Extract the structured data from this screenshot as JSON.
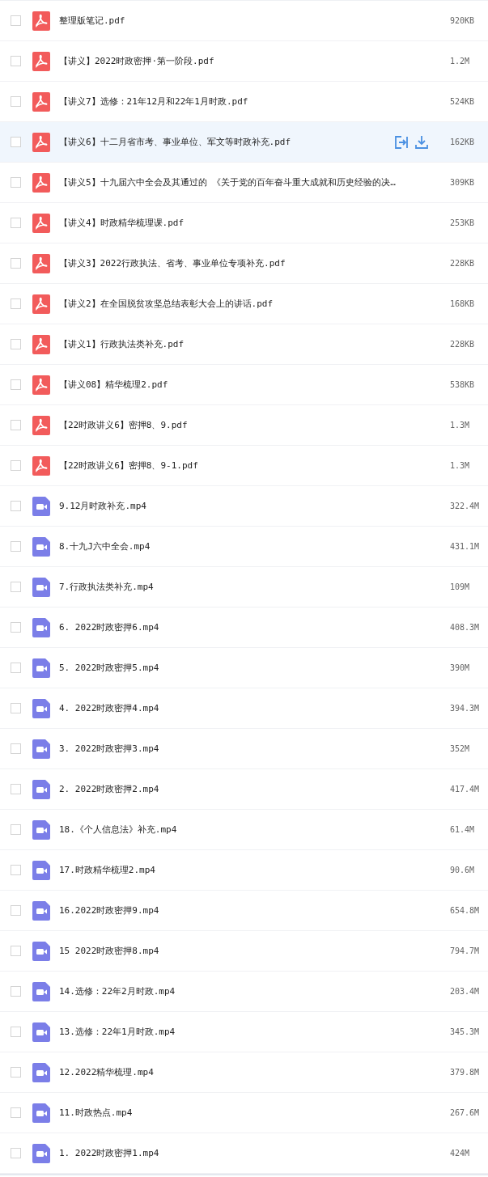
{
  "files": [
    {
      "kind": "pdf",
      "name": "整理版笔记.pdf",
      "size": "920KB",
      "checked": false,
      "hovered": false
    },
    {
      "kind": "pdf",
      "name": "【讲义】2022时政密押·第一阶段.pdf",
      "size": "1.2M",
      "checked": false,
      "hovered": false
    },
    {
      "kind": "pdf",
      "name": "【讲义7】选修：21年12月和22年1月时政.pdf",
      "size": "524KB",
      "checked": false,
      "hovered": false
    },
    {
      "kind": "pdf",
      "name": "【讲义6】十二月省市考、事业单位、军文等时政补充.pdf",
      "size": "162KB",
      "checked": false,
      "hovered": true
    },
    {
      "kind": "pdf",
      "name": "【讲义5】十九届六中全会及其通过的 《关于党的百年奋斗重大成就和历史经验的决…",
      "size": "309KB",
      "checked": false,
      "hovered": false
    },
    {
      "kind": "pdf",
      "name": "【讲义4】时政精华梳理课.pdf",
      "size": "253KB",
      "checked": false,
      "hovered": false
    },
    {
      "kind": "pdf",
      "name": "【讲义3】2022行政执法、省考、事业单位专项补充.pdf",
      "size": "228KB",
      "checked": false,
      "hovered": false
    },
    {
      "kind": "pdf",
      "name": "【讲义2】在全国脱贫攻坚总结表彰大会上的讲话.pdf",
      "size": "168KB",
      "checked": false,
      "hovered": false
    },
    {
      "kind": "pdf",
      "name": "【讲义1】行政执法类补充.pdf",
      "size": "228KB",
      "checked": false,
      "hovered": false
    },
    {
      "kind": "pdf",
      "name": "【讲义08】精华梳理2.pdf",
      "size": "538KB",
      "checked": false,
      "hovered": false
    },
    {
      "kind": "pdf",
      "name": "【22时政讲义6】密押8、9.pdf",
      "size": "1.3M",
      "checked": false,
      "hovered": false
    },
    {
      "kind": "pdf",
      "name": "【22时政讲义6】密押8、9-1.pdf",
      "size": "1.3M",
      "checked": false,
      "hovered": false
    },
    {
      "kind": "video",
      "name": "9.12月时政补充.mp4",
      "size": "322.4M",
      "checked": false,
      "hovered": false
    },
    {
      "kind": "video",
      "name": "8.十九J六中全会.mp4",
      "size": "431.1M",
      "checked": false,
      "hovered": false
    },
    {
      "kind": "video",
      "name": "7.行政执法类补充.mp4",
      "size": "109M",
      "checked": false,
      "hovered": false
    },
    {
      "kind": "video",
      "name": "6. 2022时政密押6.mp4",
      "size": "408.3M",
      "checked": false,
      "hovered": false
    },
    {
      "kind": "video",
      "name": "5. 2022时政密押5.mp4",
      "size": "390M",
      "checked": false,
      "hovered": false
    },
    {
      "kind": "video",
      "name": "4. 2022时政密押4.mp4",
      "size": "394.3M",
      "checked": false,
      "hovered": false
    },
    {
      "kind": "video",
      "name": "3. 2022时政密押3.mp4",
      "size": "352M",
      "checked": false,
      "hovered": false
    },
    {
      "kind": "video",
      "name": "2. 2022时政密押2.mp4",
      "size": "417.4M",
      "checked": false,
      "hovered": false
    },
    {
      "kind": "video",
      "name": "18.《个人信息法》补充.mp4",
      "size": "61.4M",
      "checked": false,
      "hovered": false
    },
    {
      "kind": "video",
      "name": "17.时政精华梳理2.mp4",
      "size": "90.6M",
      "checked": false,
      "hovered": false
    },
    {
      "kind": "video",
      "name": "16.2022时政密押9.mp4",
      "size": "654.8M",
      "checked": false,
      "hovered": false
    },
    {
      "kind": "video",
      "name": "15 2022时政密押8.mp4",
      "size": "794.7M",
      "checked": false,
      "hovered": false
    },
    {
      "kind": "video",
      "name": "14.选修：22年2月时政.mp4",
      "size": "203.4M",
      "checked": false,
      "hovered": false
    },
    {
      "kind": "video",
      "name": "13.选修：22年1月时政.mp4",
      "size": "345.3M",
      "checked": false,
      "hovered": false
    },
    {
      "kind": "video",
      "name": "12.2022精华梳理.mp4",
      "size": "379.8M",
      "checked": false,
      "hovered": false
    },
    {
      "kind": "video",
      "name": "11.时政热点.mp4",
      "size": "267.6M",
      "checked": false,
      "hovered": false
    },
    {
      "kind": "video",
      "name": "1. 2022时政密押1.mp4",
      "size": "424M",
      "checked": false,
      "hovered": false
    }
  ]
}
